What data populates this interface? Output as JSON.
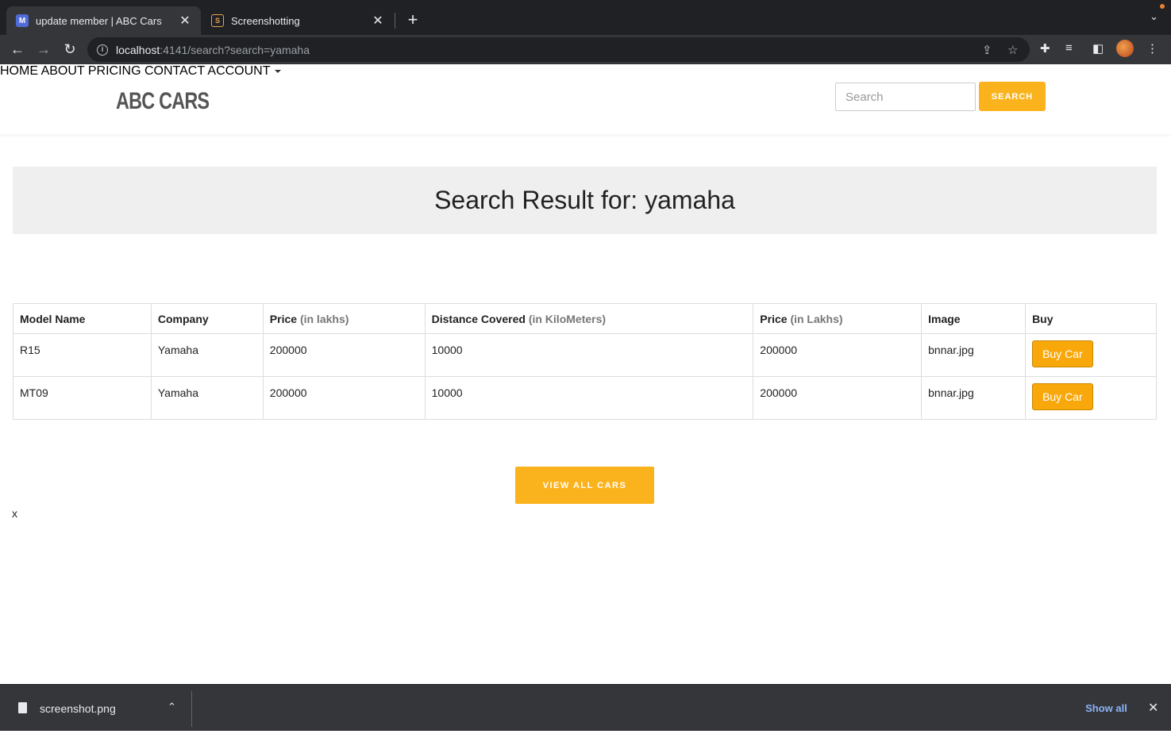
{
  "browser": {
    "tabs": [
      {
        "title": "update member | ABC Cars",
        "favicon": "M",
        "active": true
      },
      {
        "title": "Screenshotting",
        "favicon": "S",
        "active": false
      }
    ],
    "close_glyph": "✕",
    "new_tab_glyph": "+",
    "tab_menu_glyph": "⌄",
    "url_host": "localhost",
    "url_rest": ":4141/search?search=yamaha",
    "icons": [
      "back-arrow-icon",
      "forward-arrow-icon",
      "reload-icon",
      "info-icon",
      "share-icon",
      "star-icon",
      "extensions-icon",
      "reading-list-icon",
      "side-panel-icon",
      "profile-avatar",
      "kebab-menu-icon"
    ]
  },
  "site": {
    "logo": "ABC CARS",
    "nav": {
      "home": "HOME",
      "about": "ABOUT",
      "pricing": "PRICING",
      "contact": "CONTACT",
      "account": "ACCOUNT"
    },
    "search_placeholder": "Search",
    "search_button": "SEARCH",
    "accent_color": "#fbb31d"
  },
  "banner": {
    "heading": "Search Result for: yamaha"
  },
  "table": {
    "headers": {
      "model": "Model Name",
      "company": "Company",
      "price1": "Price",
      "price1_unit": "(in lakhs)",
      "distance": "Distance Covered",
      "distance_unit": "(in KiloMeters)",
      "price2": "Price",
      "price2_unit": "(in Lakhs)",
      "image": "Image",
      "buy": "Buy"
    },
    "rows": [
      {
        "model": "R15",
        "company": "Yamaha",
        "price1": "200000",
        "distance": "10000",
        "price2": "200000",
        "image": "bnnar.jpg",
        "buy_label": "Buy Car"
      },
      {
        "model": "MT09",
        "company": "Yamaha",
        "price1": "200000",
        "distance": "10000",
        "price2": "200000",
        "image": "bnnar.jpg",
        "buy_label": "Buy Car"
      }
    ]
  },
  "view_all_button": "VIEW ALL CARS",
  "stray_text": "x",
  "download_bar": {
    "file_name": "screenshot.png",
    "show_all": "Show all"
  }
}
